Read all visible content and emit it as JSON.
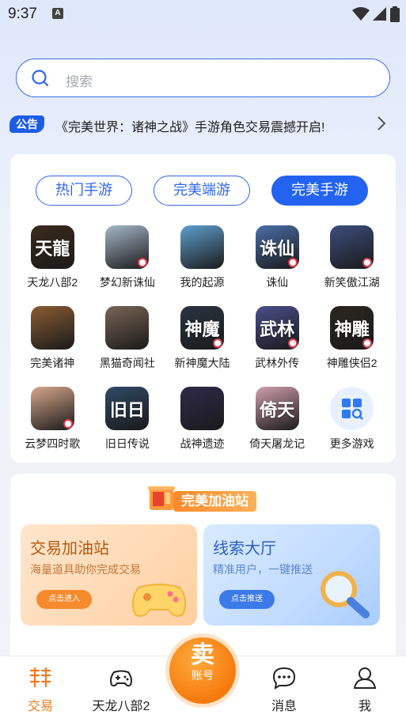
{
  "status": {
    "time": "9:37",
    "badge": "A"
  },
  "search": {
    "placeholder": "搜索"
  },
  "notice": {
    "badge": "公告",
    "text": "《完美世界：诸神之战》手游角色交易震撼开启!"
  },
  "tabs": [
    {
      "label": "热门手游",
      "active": false
    },
    {
      "label": "完美端游",
      "active": false
    },
    {
      "label": "完美手游",
      "active": true
    }
  ],
  "games": [
    {
      "name": "天龙八部2",
      "glyph": "天龍",
      "color": "#3a2a1c",
      "badge": false
    },
    {
      "name": "梦幻新诛仙",
      "glyph": "",
      "color": "#a7b8c9",
      "badge": true
    },
    {
      "name": "我的起源",
      "glyph": "",
      "color": "#5f9fcf",
      "badge": false
    },
    {
      "name": "诛仙",
      "glyph": "诛仙",
      "color": "#4b6ea8",
      "badge": true
    },
    {
      "name": "新笑傲江湖",
      "glyph": "",
      "color": "#3d4e7c",
      "badge": true
    },
    {
      "name": "完美诸神",
      "glyph": "",
      "color": "#8a5c33",
      "badge": false
    },
    {
      "name": "黑猫奇闻社",
      "glyph": "",
      "color": "#7a6455",
      "badge": false
    },
    {
      "name": "新神魔大陆",
      "glyph": "神魔",
      "color": "#2b3442",
      "badge": true
    },
    {
      "name": "武林外传",
      "glyph": "武林",
      "color": "#4a4f8a",
      "badge": true
    },
    {
      "name": "神雕侠侣2",
      "glyph": "神雕",
      "color": "#2c2620",
      "badge": true
    },
    {
      "name": "云梦四时歌",
      "glyph": "",
      "color": "#d7a78b",
      "badge": true
    },
    {
      "name": "旧日传说",
      "glyph": "旧日",
      "color": "#314a66",
      "badge": false
    },
    {
      "name": "战神遗迹",
      "glyph": "",
      "color": "#2f2a4a",
      "badge": false
    },
    {
      "name": "倚天屠龙记",
      "glyph": "倚天",
      "color": "#cf9fae",
      "badge": false
    },
    {
      "name": "更多游戏",
      "glyph": "",
      "color": "#e8f0fe",
      "badge": false,
      "more": true
    }
  ],
  "station": {
    "title": "完美加油站",
    "trade": {
      "title": "交易加油站",
      "subtitle": "海量道具助你完成交易",
      "button": "点击进入"
    },
    "clue": {
      "title": "线索大厅",
      "subtitle": "精准用户，一键推送",
      "button": "点击推送"
    }
  },
  "tabbar": {
    "items": [
      {
        "label": "交易",
        "icon": "trade-icon",
        "active": true
      },
      {
        "label": "天龙八部2",
        "icon": "gamepad-icon",
        "active": false
      },
      {
        "label": "消息",
        "icon": "chat-icon",
        "active": false
      },
      {
        "label": "我",
        "icon": "person-icon",
        "active": false
      }
    ],
    "sell": {
      "main": "卖",
      "sub": "账号"
    }
  },
  "colors": {
    "accent": "#2363f0",
    "orange": "#f77a0e"
  }
}
